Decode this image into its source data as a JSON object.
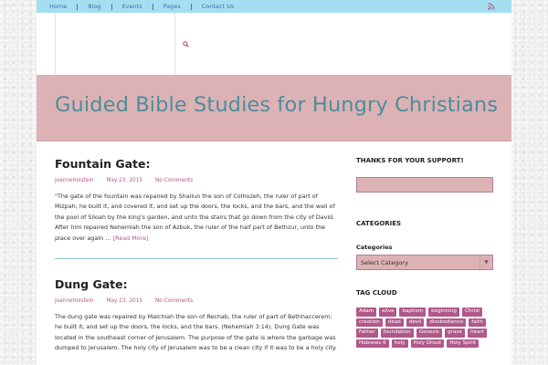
{
  "nav": {
    "items": [
      "Home",
      "Blog",
      "Events",
      "Pages",
      "Contact Us"
    ]
  },
  "header": {
    "site_title": "Guided Bible Studies for Hungry Christians"
  },
  "posts": [
    {
      "title": "Fountain Gate:",
      "author": "joanneholstein",
      "date": "May 23, 2015",
      "comments": "No Comments",
      "excerpt_lines": [
        "\"The gate of the fountain was repaired by Shallun the son of Colhozeh, the ruler of part of",
        "Mizpah; he built it, and covered it, and set up the doors, the locks, and the bars, and the wall of",
        "the pool of Siloah by the king's garden, and unto the stairs that go down from the city of David.",
        "After him repaired Nehemiah the son of Azbuk, the ruler of the half part of Bethzur, unto the",
        "place over again … "
      ],
      "read_more": "[Read More]"
    },
    {
      "title": "Dung Gate:",
      "author": "joanneholstein",
      "date": "May 23, 2015",
      "comments": "No Comments",
      "excerpt_lines": [
        "The dung gate was repaired by Malchiah the son of Rechab, the ruler of part of Bethhaccerem;",
        "he built it, and set up the doors, the locks, and the bars. (Nehemiah 3:14). Dung Gate was",
        "located in the southeast corner of Jerusalem. The purpose of the gate is where the garbage was",
        "dumped to Jerusalem. The holy city of Jerusalem was to be a clean city if it was to be a holy city."
      ]
    }
  ],
  "sidebar": {
    "support_title": "THANKS FOR YOUR SUPPORT!",
    "categories_title": "CATEGORIES",
    "categories_label": "Categories",
    "categories_select": "Select Category",
    "tagcloud_title": "TAG CLOUD",
    "tags": [
      "Adam",
      "alive",
      "baptism",
      "beginning",
      "Christ",
      "creation",
      "dead",
      "devil",
      "disobedience",
      "faith",
      "Father",
      "foundation",
      "Genesis",
      "grave",
      "heart",
      "Hebrews 6",
      "holy",
      "Holy Ghost",
      "Holy Spirit"
    ]
  },
  "icons": {
    "search": "search-icon",
    "rss": "rss-icon",
    "dropdown": "chevron-down-icon"
  },
  "colors": {
    "topbar": "#a4dff1",
    "banner": "#ddb2b5",
    "title": "#4b8e9d",
    "accent": "#b0588a"
  }
}
